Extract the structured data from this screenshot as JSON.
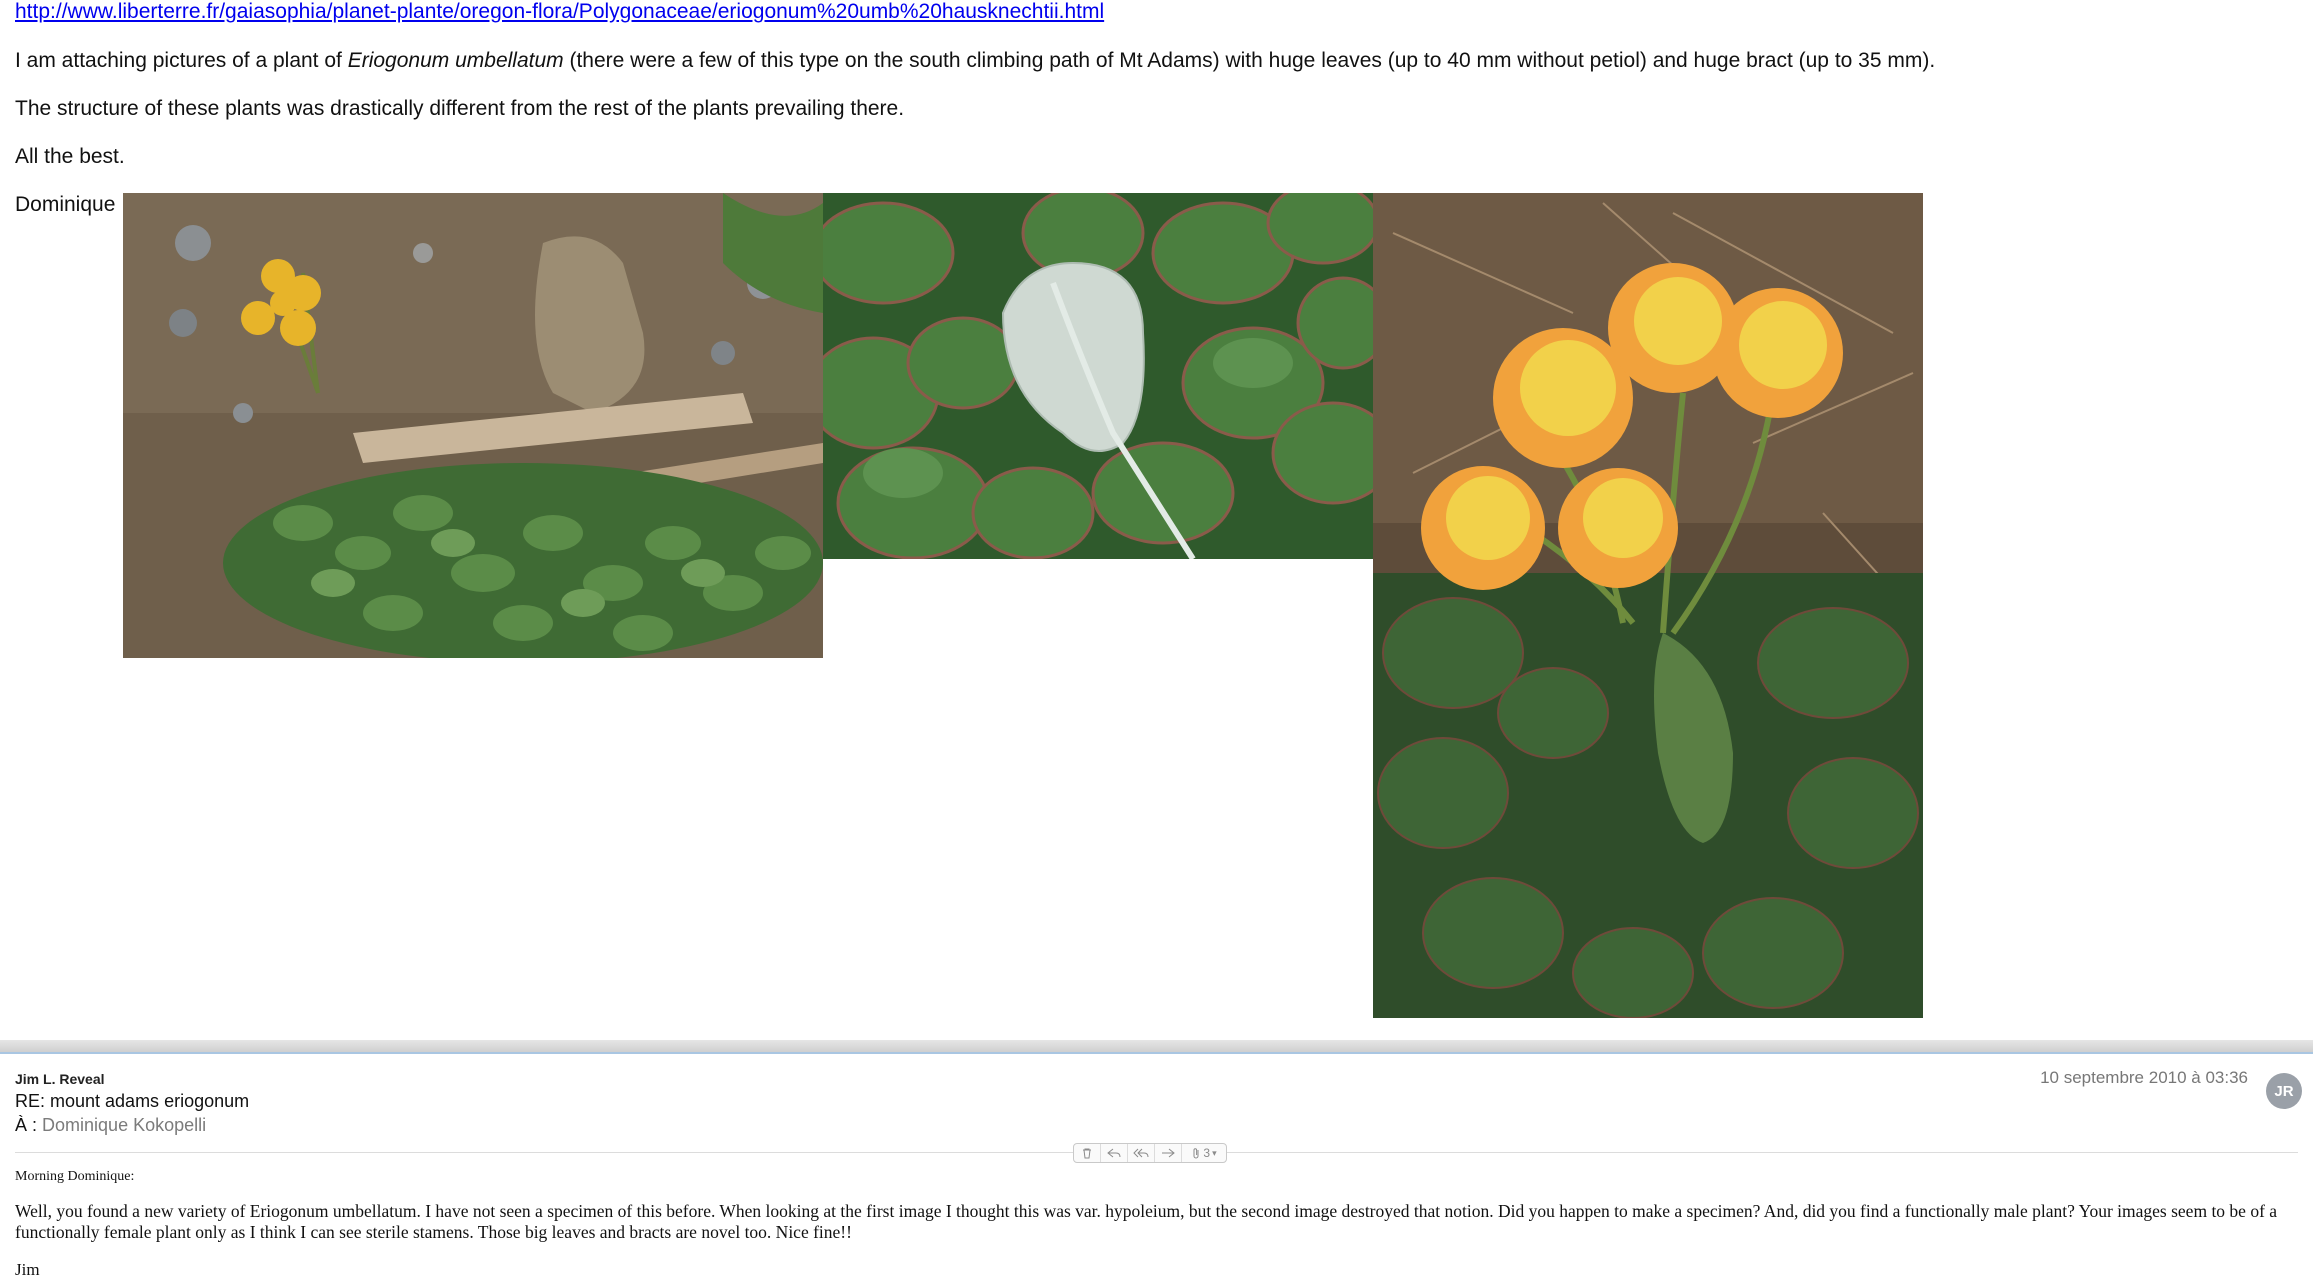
{
  "message1": {
    "link": "http://www.liberterre.fr/gaiasophia/planet-plante/oregon-flora/Polygonaceae/eriogonum%20umb%20hausknechtii.html",
    "p1_before": "I am attaching pictures of a plant of ",
    "p1_species": "Eriogonum umbellatum",
    "p1_after": " (there were a  few of this type on the south climbing path of Mt Adams) with huge leaves (up to 40 mm without petiol) and huge bract (up to 35 mm).",
    "p2": "The structure of these plants was drastically different from the rest of the plants prevailing there.",
    "p3": "All the best.",
    "signature": "Dominique"
  },
  "reply": {
    "sender": "Jim L. Reveal",
    "subject": "RE: mount adams eriogonum",
    "to_label": "À :",
    "to_name": "Dominique Kokopelli",
    "date": "10 septembre 2010 à 03:36",
    "avatar_initials": "JR",
    "attachments_count": "3",
    "greeting": "Morning Dominique:",
    "body": "Well, you found a new variety of Eriogonum umbellatum. I have not seen a specimen of this before. When looking at the first image I thought this was var. hypoleium, but the second image destroyed that notion. Did you happen to make a specimen? And, did you find a functionally male plant? Your images seem to be of a functionally female plant only as I think I can see sterile stamens. Those big leaves and bracts are novel too. Nice fine!!",
    "signoff": "Jim"
  }
}
